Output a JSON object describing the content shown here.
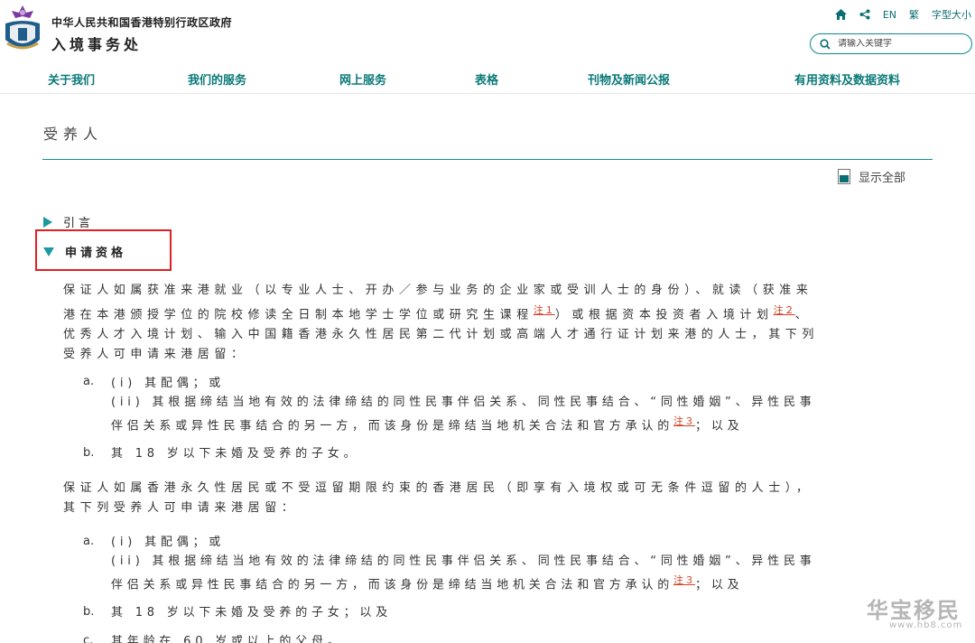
{
  "header": {
    "gov_name": "中华人民共和国香港特别行政区政府",
    "dept_name": "入境事务处",
    "utility": {
      "lang_en": "EN",
      "lang_trad": "繁",
      "font_size": "字型大小"
    },
    "search_placeholder": "请输入关键字"
  },
  "nav": [
    {
      "label": "关于我们"
    },
    {
      "label": "我们的服务"
    },
    {
      "label": "网上服务"
    },
    {
      "label": "表格"
    },
    {
      "label": "刊物及新闻公报"
    },
    {
      "label": "有用资料及数据资料"
    }
  ],
  "content": {
    "page_title": "受养人",
    "show_all": "显示全部",
    "sections": [
      {
        "label": "引言"
      },
      {
        "label": "申请资格"
      }
    ],
    "para1": {
      "line1": "保证人如属获准来港就业（以专业人士、开办／参与业务的企业家或受训人士的身份）、就读（获准来",
      "line2a": "港在本港颁授学位的院校修读全日制本地学士学位或研究生课程",
      "note1": "注１",
      "line2b": "）或根据资本投资者入境计划",
      "note2": "注２",
      "line2c": "、",
      "line3": "优秀人才入境计划、输入中国籍香港永久性居民第二代计划或高端人才通行证计划来港的人士，其下列",
      "line4": "受养人可申请来港居留："
    },
    "list1": {
      "a_marker": "a.",
      "a_i": "(i) 其配偶；或",
      "a_ii_1": "(ii) 其根据缔结当地有效的法律缔结的同性民事伴侣关系、同性民事结合、“同性婚姻”、异性民事",
      "a_ii_2a": "伴侣关系或异性民事结合的另一方，而该身份是缔结当地机关合法和官方承认的",
      "note3": "注３",
      "a_ii_2b": "；以及",
      "b_marker": "b.",
      "b_text": "其 18 岁以下未婚及受养的子女。"
    },
    "para2": {
      "line1": "保证人如属香港永久性居民或不受逗留期限约束的香港居民（即享有入境权或可无条件逗留的人士），",
      "line2": "其下列受养人可申请来港居留："
    },
    "list2": {
      "a_marker": "a.",
      "a_i": "(i) 其配偶；或",
      "a_ii_1": "(ii) 其根据缔结当地有效的法律缔结的同性民事伴侣关系、同性民事结合、“同性婚姻”、异性民事",
      "a_ii_2a": "伴侣关系或异性民事结合的另一方，而该身份是缔结当地机关合法和官方承认的",
      "note3": "注３",
      "a_ii_2b": "；以及",
      "b_marker": "b.",
      "b_text": "其 18 岁以下未婚及受养的子女；以及",
      "c_marker": "c.",
      "c_text": "其年龄在 60 岁或以上的父母。"
    }
  },
  "watermark": {
    "text": "华宝移民",
    "sub": "www.hb8.com"
  },
  "colors": {
    "accent": "#0b7a78",
    "triangle": "#1a9aa0",
    "highlight": "#e02020",
    "note": "#d04020"
  }
}
